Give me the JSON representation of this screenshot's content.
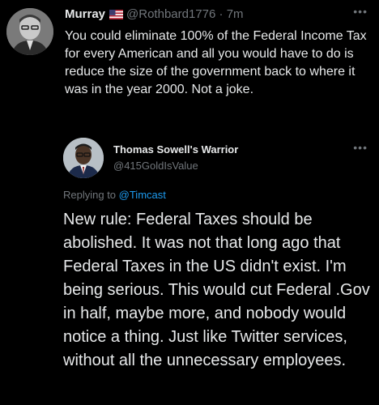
{
  "tweet": {
    "author_name": "Murray",
    "flag_icon": "us-flag-icon",
    "author_handle": "@Rothbard1776",
    "separator": "·",
    "time": "7m",
    "more_icon": "more-dots-icon",
    "text": "You could eliminate 100% of the Federal Income Tax for every American and all you would have to do is reduce the size of the government back to where it was in the year 2000. Not a joke."
  },
  "quoted_tweet": {
    "author_name": "Thomas Sowell's Warrior",
    "author_handle": "@415GoldIsValue",
    "more_icon": "more-dots-icon",
    "replying_prefix": "Replying to ",
    "replying_mention": "@Timcast",
    "text": "New rule: Federal Taxes should be abolished. It was not that long ago that Federal Taxes in the US didn't exist. I'm being serious. This would cut Federal .Gov in half, maybe more, and nobody would notice a thing. Just like Twitter services, without all the unnecessary employees."
  },
  "colors": {
    "background": "#000000",
    "text_primary": "#e7e9ea",
    "text_secondary": "#71767b",
    "link": "#1d9bf0"
  }
}
